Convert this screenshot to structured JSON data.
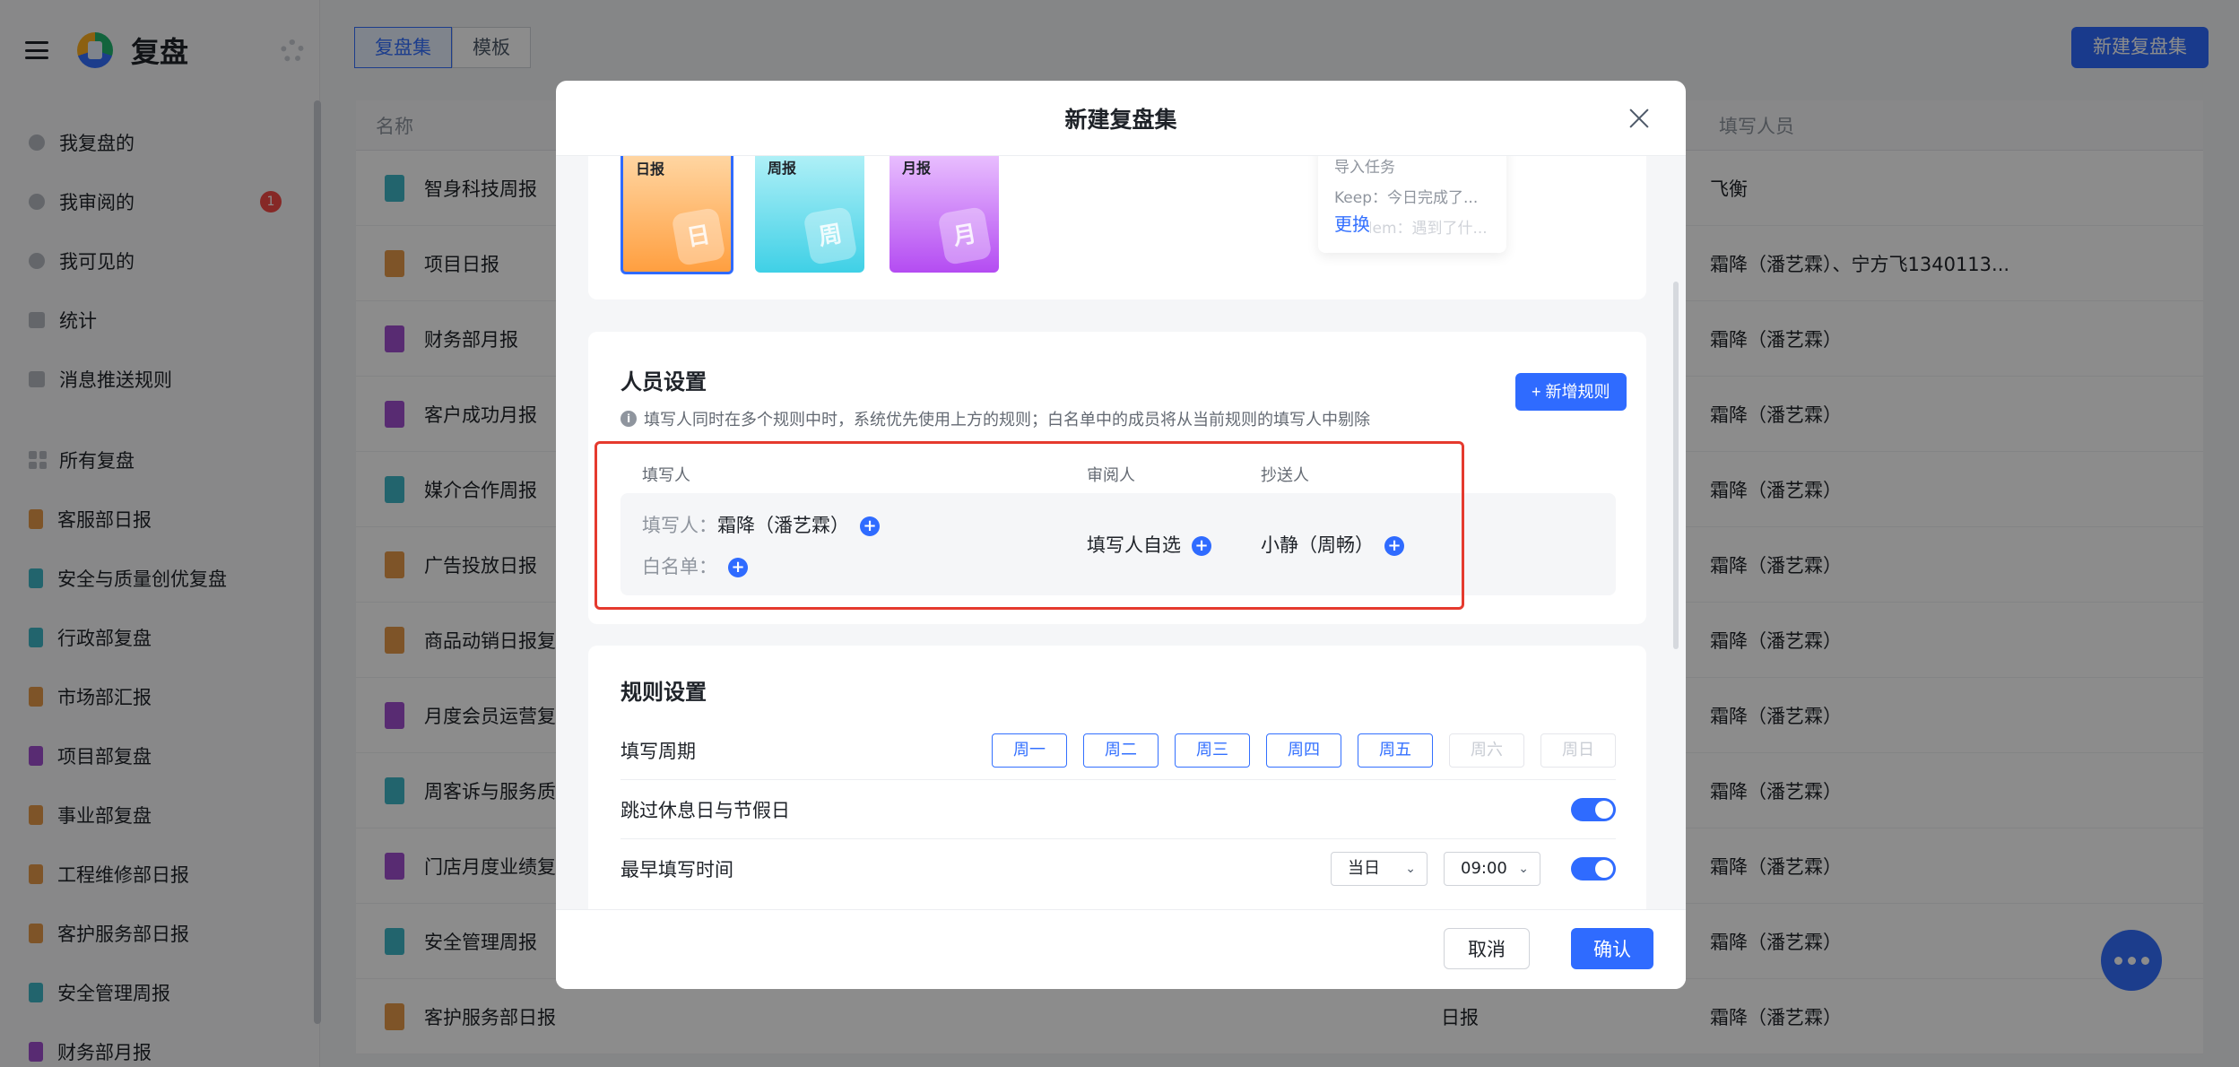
{
  "app": {
    "title": "复盘"
  },
  "sidebar": {
    "items": [
      {
        "label": "我复盘的"
      },
      {
        "label": "我审阅的",
        "badge": "1"
      },
      {
        "label": "我可见的"
      },
      {
        "label": "统计"
      },
      {
        "label": "消息推送规则"
      }
    ],
    "group_title": "所有复盘",
    "sets": [
      {
        "label": "客服部日报",
        "color": "#e69a4a"
      },
      {
        "label": "安全与质量创优复盘",
        "color": "#3fb7c7"
      },
      {
        "label": "行政部复盘",
        "color": "#3fb7c7"
      },
      {
        "label": "市场部汇报",
        "color": "#e69a4a"
      },
      {
        "label": "项目部复盘",
        "color": "#a04fd0"
      },
      {
        "label": "事业部复盘",
        "color": "#e69a4a"
      },
      {
        "label": "工程维修部日报",
        "color": "#e69a4a"
      },
      {
        "label": "客护服务部日报",
        "color": "#e69a4a"
      },
      {
        "label": "安全管理周报",
        "color": "#3fb7c7"
      },
      {
        "label": "财务部月报",
        "color": "#a04fd0"
      }
    ]
  },
  "topbar": {
    "tabs": [
      "复盘集",
      "模板"
    ],
    "active_tab": "复盘集",
    "new_set_label": "新建复盘集"
  },
  "table": {
    "headers": {
      "name": "名称",
      "fill": "填写人员"
    },
    "rows": [
      {
        "name": "智身科技周报",
        "type": "",
        "fill": "飞衡",
        "color": "#3fb7c7"
      },
      {
        "name": "项目日报",
        "type": "",
        "fill": "霜降（潘艺霖）、宁方飞1340113...",
        "color": "#e69a4a"
      },
      {
        "name": "财务部月报",
        "type": "",
        "fill": "霜降（潘艺霖）",
        "color": "#a04fd0"
      },
      {
        "name": "客户成功月报",
        "type": "",
        "fill": "霜降（潘艺霖）",
        "color": "#a04fd0"
      },
      {
        "name": "媒介合作周报",
        "type": "",
        "fill": "霜降（潘艺霖）",
        "color": "#3fb7c7"
      },
      {
        "name": "广告投放日报",
        "type": "",
        "fill": "霜降（潘艺霖）",
        "color": "#e69a4a"
      },
      {
        "name": "商品动销日报复盘",
        "type": "",
        "fill": "霜降（潘艺霖）",
        "color": "#e69a4a"
      },
      {
        "name": "月度会员运营复盘",
        "type": "",
        "fill": "霜降（潘艺霖）",
        "color": "#a04fd0"
      },
      {
        "name": "周客诉与服务质量",
        "type": "",
        "fill": "霜降（潘艺霖）",
        "color": "#3fb7c7"
      },
      {
        "name": "门店月度业绩复盘",
        "type": "",
        "fill": "霜降（潘艺霖）",
        "color": "#a04fd0"
      },
      {
        "name": "安全管理周报",
        "type": "",
        "fill": "霜降（潘艺霖）",
        "color": "#3fb7c7"
      },
      {
        "name": "客护服务部日报",
        "type": "日报",
        "fill": "霜降（潘艺霖）",
        "color": "#e69a4a"
      }
    ]
  },
  "modal": {
    "title": "新建复盘集",
    "templates": [
      {
        "label": "日报",
        "glyph": "日"
      },
      {
        "label": "周报",
        "glyph": "周"
      },
      {
        "label": "月报",
        "glyph": "月"
      }
    ],
    "preview": {
      "line1": "导入任务",
      "line2": "Keep：今日完成了...",
      "line3": "Problem：遇到了什...",
      "change_label": "更换"
    },
    "people": {
      "title": "人员设置",
      "tip": "填写人同时在多个规则中时，系统优先使用上方的规则；白名单中的成员将从当前规则的填写人中剔除",
      "add_rule_label": "+ 新增规则",
      "columns": {
        "writer": "填写人",
        "reviewer": "审阅人",
        "cc": "抄送人"
      },
      "rule": {
        "writer_label": "填写人：",
        "writer_value": "霜降（潘艺霖）",
        "whitelist_label": "白名单：",
        "reviewer_value": "填写人自选",
        "cc_value": "小静（周畅）"
      }
    },
    "rules": {
      "title": "规则设置",
      "cycle_label": "填写周期",
      "days": [
        {
          "label": "周一",
          "on": true
        },
        {
          "label": "周二",
          "on": true
        },
        {
          "label": "周三",
          "on": true
        },
        {
          "label": "周四",
          "on": true
        },
        {
          "label": "周五",
          "on": true
        },
        {
          "label": "周六",
          "on": false
        },
        {
          "label": "周日",
          "on": false
        }
      ],
      "skip_holiday_label": "跳过休息日与节假日",
      "skip_holiday_on": true,
      "earliest_label": "最早填写时间",
      "earliest_day": "当日",
      "earliest_time": "09:00",
      "earliest_on": true
    },
    "footer": {
      "cancel_label": "取消",
      "ok_label": "确认"
    }
  }
}
